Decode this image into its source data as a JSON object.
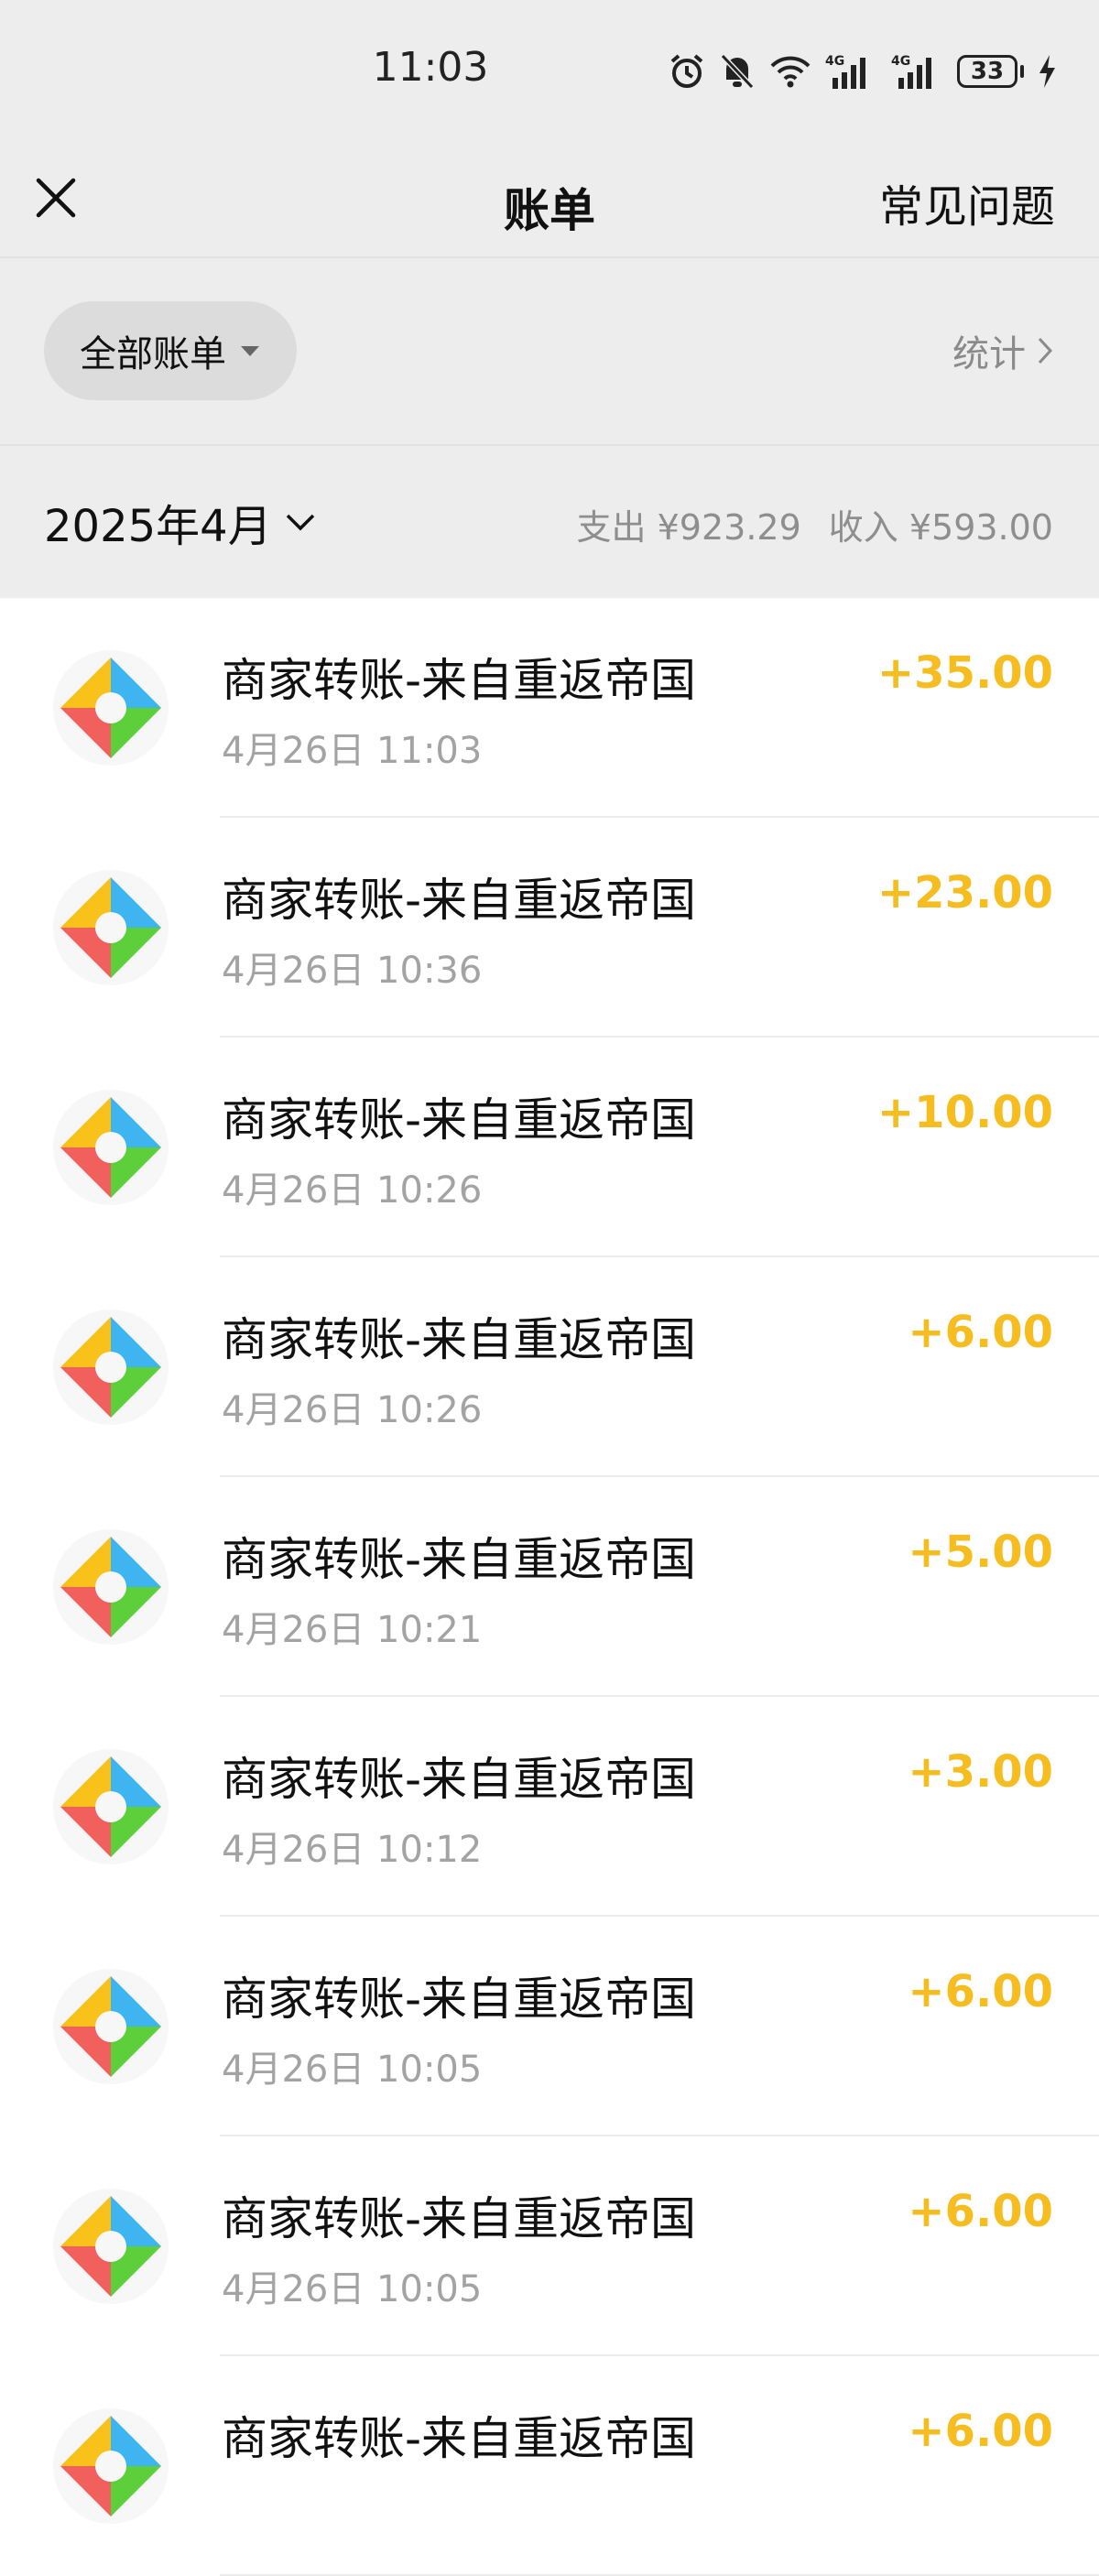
{
  "status_bar": {
    "time": "11:03",
    "battery": "33",
    "signal_label": "4G",
    "icons": [
      "alarm-icon",
      "mute-bell-icon",
      "wifi-icon",
      "signal-4g-icon",
      "signal-4g-icon",
      "battery-icon",
      "charging-icon"
    ]
  },
  "nav": {
    "title": "账单",
    "faq_label": "常见问题",
    "close_icon": "close-icon"
  },
  "filter": {
    "label": "全部账单",
    "stats_label": "统计"
  },
  "month": {
    "label": "2025年4月",
    "expense": "支出 ¥923.29",
    "income": "收入 ¥593.00"
  },
  "colors": {
    "income_amount": "#f5bd1f",
    "background": "#ededed",
    "logo": [
      "#f9c21b",
      "#3eb5f1",
      "#f2605d",
      "#5ccf3a"
    ]
  },
  "transactions": [
    {
      "title": "商家转账-来自重返帝国",
      "time": "4月26日 11:03",
      "amount": "+35.00"
    },
    {
      "title": "商家转账-来自重返帝国",
      "time": "4月26日 10:36",
      "amount": "+23.00"
    },
    {
      "title": "商家转账-来自重返帝国",
      "time": "4月26日 10:26",
      "amount": "+10.00"
    },
    {
      "title": "商家转账-来自重返帝国",
      "time": "4月26日 10:26",
      "amount": "+6.00"
    },
    {
      "title": "商家转账-来自重返帝国",
      "time": "4月26日 10:21",
      "amount": "+5.00"
    },
    {
      "title": "商家转账-来自重返帝国",
      "time": "4月26日 10:12",
      "amount": "+3.00"
    },
    {
      "title": "商家转账-来自重返帝国",
      "time": "4月26日 10:05",
      "amount": "+6.00"
    },
    {
      "title": "商家转账-来自重返帝国",
      "time": "4月26日 10:05",
      "amount": "+6.00"
    },
    {
      "title": "商家转账-来自重返帝国",
      "time": "",
      "amount": "+6.00"
    }
  ]
}
